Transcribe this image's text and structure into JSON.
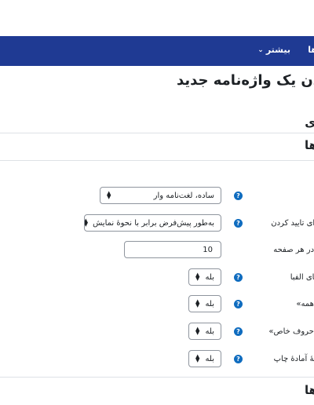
{
  "navbar": {
    "more_label": "بیشتر",
    "partial_label": "ها"
  },
  "page": {
    "title": "دن یک واژه‌نامه جدید",
    "section_char": "ی"
  },
  "sections": [
    {
      "title": "ها"
    },
    {
      "title": "ها"
    }
  ],
  "fields": {
    "display_format": {
      "value": "ساده، لغت‌نامه وار"
    },
    "approval_display": {
      "label": "رای تایید کردن",
      "value": "به‌طور پیش‌فرض برابر با نحوهٔ نمایش"
    },
    "entries_per_page": {
      "label": "ا در هر صفحه",
      "value": "10"
    },
    "show_alphabet": {
      "label": "های الفبا",
      "value": "بله"
    },
    "show_all": {
      "label": "«همه»",
      "value": "بله"
    },
    "show_special": {
      "label": "«حروف خاص»",
      "value": "بله"
    },
    "print_view": {
      "label": "خهٔ آمادهٔ چاپ",
      "value": "بله"
    }
  },
  "icons": {
    "help": "question-circle-icon",
    "select": "select-arrows-icon",
    "dropdown": "chevron-down-icon"
  },
  "colors": {
    "navbar": "#1f3a93",
    "help": "#0f6cbf"
  }
}
